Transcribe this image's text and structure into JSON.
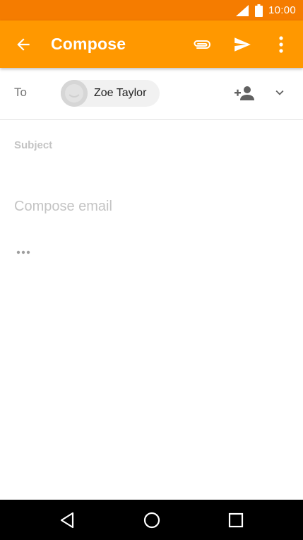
{
  "status_bar": {
    "time": "10:00",
    "icons": [
      "signal-icon",
      "battery-icon"
    ]
  },
  "app_bar": {
    "title": "Compose",
    "icons": [
      "back-arrow-icon",
      "attach-icon",
      "send-icon",
      "more-vert-icon"
    ],
    "background": "#ff9800",
    "status_background": "#f57c00"
  },
  "recipients": {
    "to_label": "To",
    "chips": [
      {
        "name": "Zoe Taylor",
        "avatar": "default-avatar-icon"
      }
    ],
    "icons": [
      "add-person-icon",
      "expand-more-icon"
    ]
  },
  "subject": {
    "placeholder": "Subject",
    "value": ""
  },
  "body": {
    "placeholder": "Compose email",
    "value": "",
    "more_icon": "more-horiz-icon"
  },
  "nav_bar": {
    "icons": [
      "nav-back-icon",
      "nav-home-icon",
      "nav-recents-icon"
    ]
  }
}
